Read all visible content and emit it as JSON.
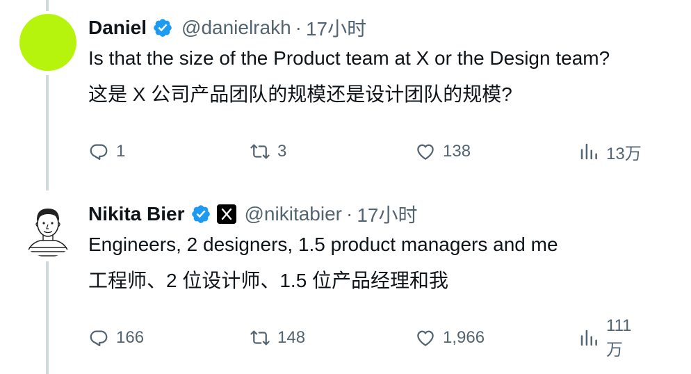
{
  "tweets": [
    {
      "name": "Daniel",
      "handle": "@danielrakh",
      "separator": "·",
      "time": "17小时",
      "text_en": "Is that the size of the Product team at X or the Design team?",
      "text_zh": "这是 X 公司产品团队的规模还是设计团队的规模?",
      "replies": "1",
      "retweets": "3",
      "likes": "138",
      "views": "13万",
      "avatar_color": "#b7f40d"
    },
    {
      "name": "Nikita Bier",
      "handle": "@nikitabier",
      "separator": "·",
      "time": "17小时",
      "text_en": "Engineers, 2 designers, 1.5 product managers and me",
      "text_zh": "工程师、2 位设计师、1.5 位产品经理和我",
      "replies": "166",
      "retweets": "148",
      "likes": "1,966",
      "views": "111万"
    }
  ],
  "colors": {
    "verified": "#1d9bf0",
    "secondary_text": "#536471",
    "primary_text": "#0f1419",
    "thread_line": "#cfd9de"
  },
  "icons": [
    "verified-badge-icon",
    "x-logo-icon",
    "reply-icon",
    "retweet-icon",
    "like-icon",
    "views-icon"
  ]
}
